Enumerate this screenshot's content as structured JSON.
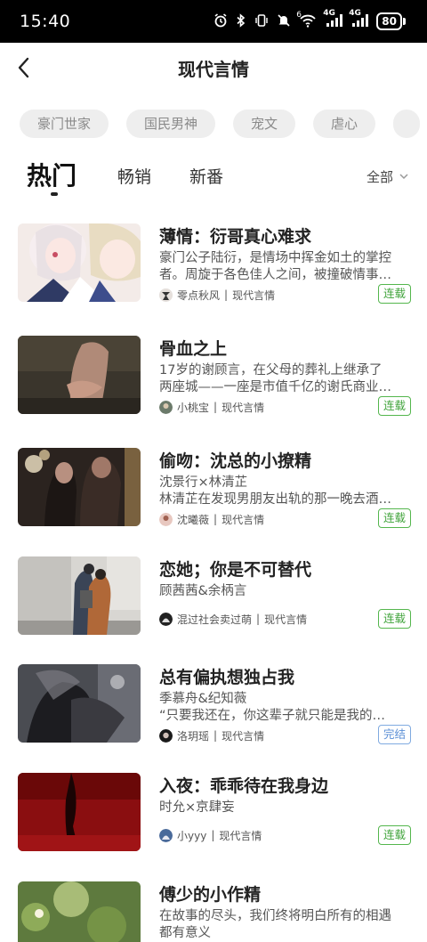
{
  "status_bar": {
    "time": "15:40",
    "battery": "80",
    "network_1": "4G",
    "network_2": "4G",
    "wifi_badge": "6",
    "icons": [
      "alarm-icon",
      "bluetooth-icon",
      "vibrate-icon",
      "mute-icon",
      "wifi-icon",
      "signal-icon",
      "signal-icon",
      "battery-icon"
    ]
  },
  "header": {
    "title": "现代言情",
    "back_icon": "chevron-left-icon"
  },
  "chips": [
    "豪门世家",
    "国民男神",
    "宠文",
    "虐心",
    ""
  ],
  "tabs": [
    {
      "label": "热门"
    },
    {
      "label": "畅销"
    },
    {
      "label": "新番"
    }
  ],
  "filter": {
    "label": "全部",
    "icon": "chevron-down-icon"
  },
  "books": [
    {
      "title": "薄情：衍哥真心难求",
      "desc_line1": "豪门公子陆衍，是情场中挥金如土的掌控",
      "desc_line2": "者。周旋于各色佳人之间，被撞破情事…",
      "author": "零点秋风",
      "category": "现代言情",
      "status": "连载"
    },
    {
      "title": "骨血之上",
      "desc_line1": "17岁的谢顾言，在父母的葬礼上继承了",
      "desc_line2": "两座城——一座是市值千亿的谢氏商业…",
      "author": "小桃宝",
      "category": "现代言情",
      "status": "连载"
    },
    {
      "title": "偷吻：沈总的小撩精",
      "desc_line1": "沈景行×林清芷",
      "desc_line2": "林清芷在发现男朋友出轨的那一晚去酒…",
      "author": "沈曦薇",
      "category": "现代言情",
      "status": "连载"
    },
    {
      "title": "恋她；你是不可替代",
      "desc_line1": "顾茜茜&余柄言",
      "desc_line2": "",
      "author": "混过社会卖过萌",
      "category": "现代言情",
      "status": "连载"
    },
    {
      "title": "总有偏执想独占我",
      "desc_line1": "季慕舟&纪知薇",
      "desc_line2": "“只要我还在，你这辈子就只能是我的…",
      "author": "洛玥瑶",
      "category": "现代言情",
      "status": "完结"
    },
    {
      "title": "入夜：乖乖待在我身边",
      "desc_line1": "时允×京肆妄",
      "desc_line2": "",
      "author": "小yyy",
      "category": "现代言情",
      "status": "连载"
    },
    {
      "title": "傅少的小作精",
      "desc_line1": "在故事的尽头，我们终将明白所有的相遇",
      "desc_line2": "都有意义",
      "author": "",
      "category": "",
      "status": ""
    }
  ],
  "meta_separator": "|"
}
